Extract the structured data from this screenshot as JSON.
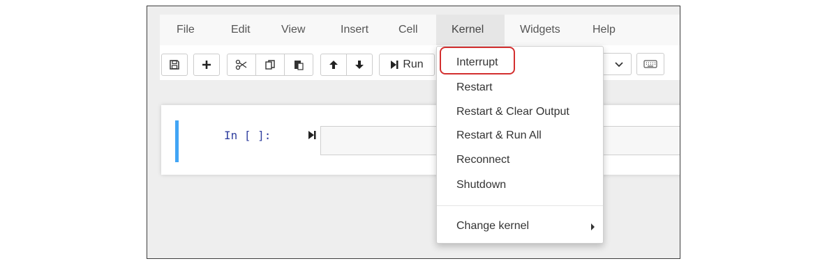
{
  "menubar": {
    "items": [
      {
        "label": "File"
      },
      {
        "label": "Edit"
      },
      {
        "label": "View"
      },
      {
        "label": "Insert"
      },
      {
        "label": "Cell"
      },
      {
        "label": "Kernel"
      },
      {
        "label": "Widgets"
      },
      {
        "label": "Help"
      }
    ],
    "open_menu": "Kernel"
  },
  "toolbar": {
    "buttons": [
      {
        "icon": "save-icon"
      },
      {
        "icon": "plus-icon"
      },
      {
        "icon": "scissors-icon"
      },
      {
        "icon": "copy-icon"
      },
      {
        "icon": "paste-icon"
      },
      {
        "icon": "arrow-up-icon"
      },
      {
        "icon": "arrow-down-icon"
      },
      {
        "icon": "run-icon"
      }
    ],
    "run_label": "Run",
    "keyboard_icon": "keyboard-icon"
  },
  "cell": {
    "prompt": "In [ ]:",
    "accent_color": "#42a5f5"
  },
  "kernel_menu": {
    "items": [
      {
        "label": "Interrupt",
        "highlighted": true
      },
      {
        "label": "Restart"
      },
      {
        "label": "Restart & Clear Output"
      },
      {
        "label": "Restart & Run All"
      },
      {
        "label": "Reconnect"
      },
      {
        "label": "Shutdown"
      }
    ],
    "submenu": {
      "label": "Change kernel"
    },
    "highlight_color": "#d32f2f"
  }
}
